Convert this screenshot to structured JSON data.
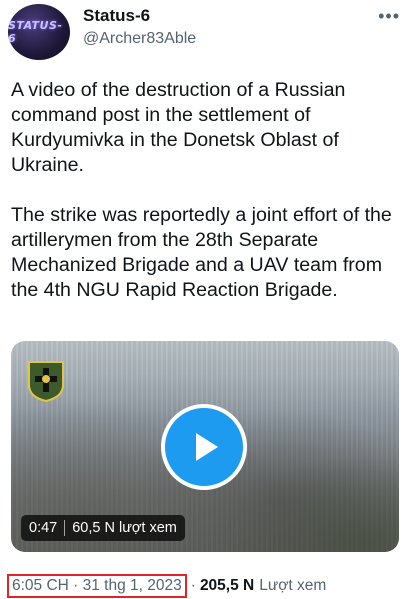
{
  "author": {
    "avatar_text": "STATUS-6",
    "display_name": "Status-6",
    "handle": "@Archer83Able",
    "more_icon": "more-horizontal-icon"
  },
  "tweet": {
    "text": "A video of the destruction of a Russian command post in the settlement of Kurdyumivka in the Donetsk Oblast of Ukraine.\n\nThe strike was reportedly a joint effort of the artillerymen from the 28th Separate Mechanized Brigade and a UAV team from the 4th NGU Rapid Reaction Brigade."
  },
  "media": {
    "duration": "0:47",
    "views": "60,5 N lượt xem",
    "play_icon": "play-icon",
    "badge_icon": "unit-emblem-icon"
  },
  "footer": {
    "timestamp": "6:05 CH · 31 thg 1, 2023",
    "separator": "·",
    "views_count": "205,5 N",
    "views_label": "Lượt xem"
  },
  "colors": {
    "accent": "#1d9bf0",
    "highlight_border": "#e0242a",
    "secondary_text": "#536471"
  }
}
